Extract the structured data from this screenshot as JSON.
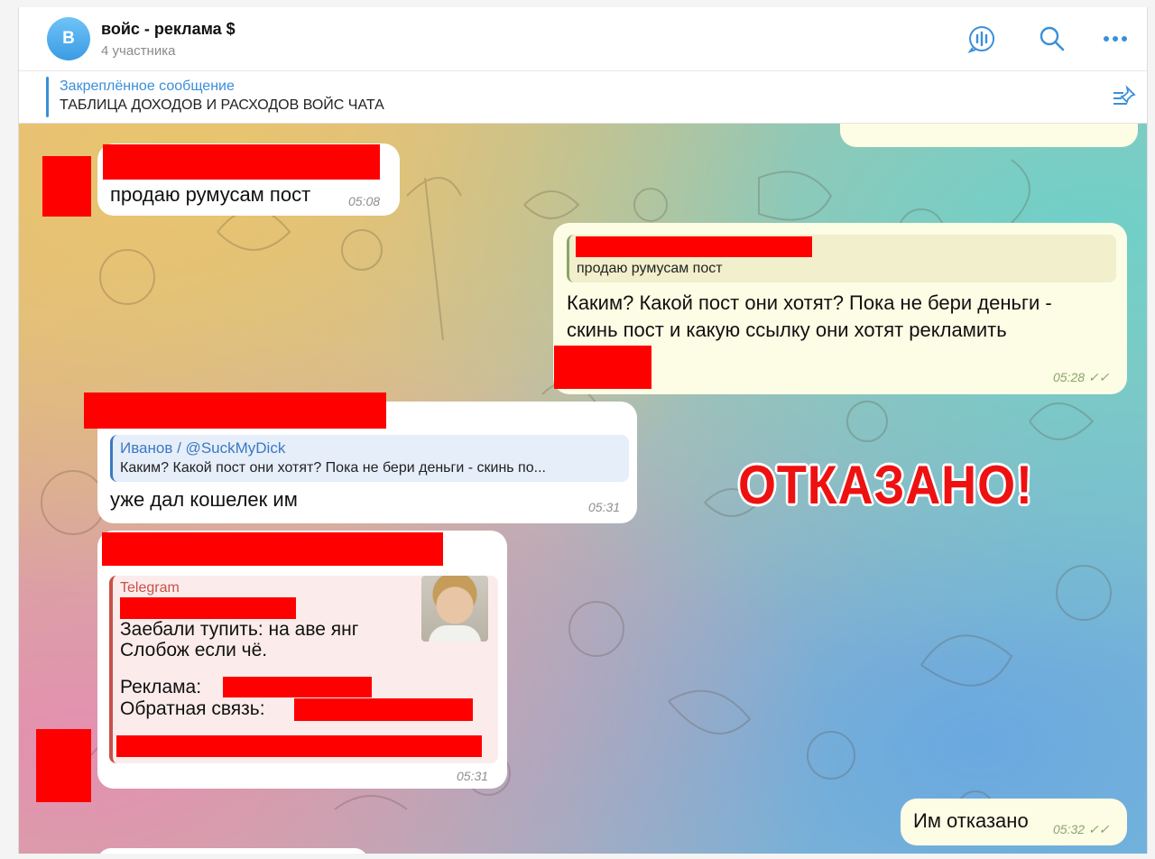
{
  "header": {
    "avatar_letter": "В",
    "title": "войс - реклама $",
    "subtitle": "4 участника",
    "icons": [
      "voice-chat-icon",
      "search-icon",
      "more-icon"
    ]
  },
  "pinned": {
    "label": "Закреплённое сообщение",
    "text": "ТАБЛИЦА ДОХОДОВ И РАСХОДОВ ВОЙС ЧАТА",
    "icon": "pinned-list-icon"
  },
  "messages": {
    "m1": {
      "text": "продаю румусам пост",
      "time": "05:08"
    },
    "m2": {
      "reply_text": "продаю румусам пост",
      "text_line1": "Каким? Какой пост они хотят? Пока не бери деньги -",
      "text_line2": "скинь пост и какую ссылку они хотят рекламить",
      "time": "05:28"
    },
    "m3": {
      "reply_author": "Иванов / @SuckMyDick",
      "reply_text": "Каким? Какой пост они хотят? Пока не бери деньги - скинь по...",
      "text": "уже дал кошелек им",
      "time": "05:31"
    },
    "m4": {
      "preview_site": "Telegram",
      "line1": "Заебали тупить: на аве янг",
      "line2": "Слобож если чё.",
      "line3": "Реклама: ",
      "line4": "Обратная связь: ",
      "time": "05:31"
    },
    "m5": {
      "text": "Им отказано",
      "time": "05:32"
    }
  },
  "stamp": "ОТКАЗАНО!",
  "colors": {
    "accent": "#3a8fd9",
    "stamp": "#ee1111",
    "redaction": "#ff0000",
    "outgoing": "#fdfce5"
  }
}
